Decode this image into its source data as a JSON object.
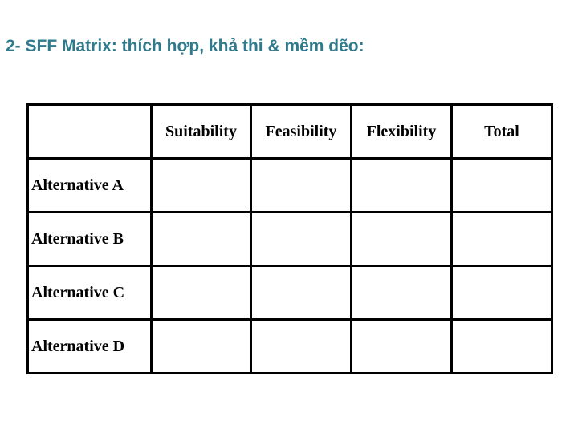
{
  "title": "2- SFF Matrix: thích hợp, khả thi &  mềm dẽo:",
  "matrix": {
    "corner": "",
    "columns": [
      "Suitability",
      "Feasibility",
      "Flexibility",
      "Total"
    ],
    "rows": [
      {
        "label": "Alternative A",
        "values": [
          "",
          "",
          "",
          ""
        ]
      },
      {
        "label": "Alternative B",
        "values": [
          "",
          "",
          "",
          ""
        ]
      },
      {
        "label": "Alternative C",
        "values": [
          "",
          "",
          "",
          ""
        ]
      },
      {
        "label": "Alternative D",
        "values": [
          "",
          "",
          "",
          ""
        ]
      }
    ]
  },
  "colors": {
    "title": "#2f7b8d",
    "border": "#000000",
    "text": "#000000"
  }
}
